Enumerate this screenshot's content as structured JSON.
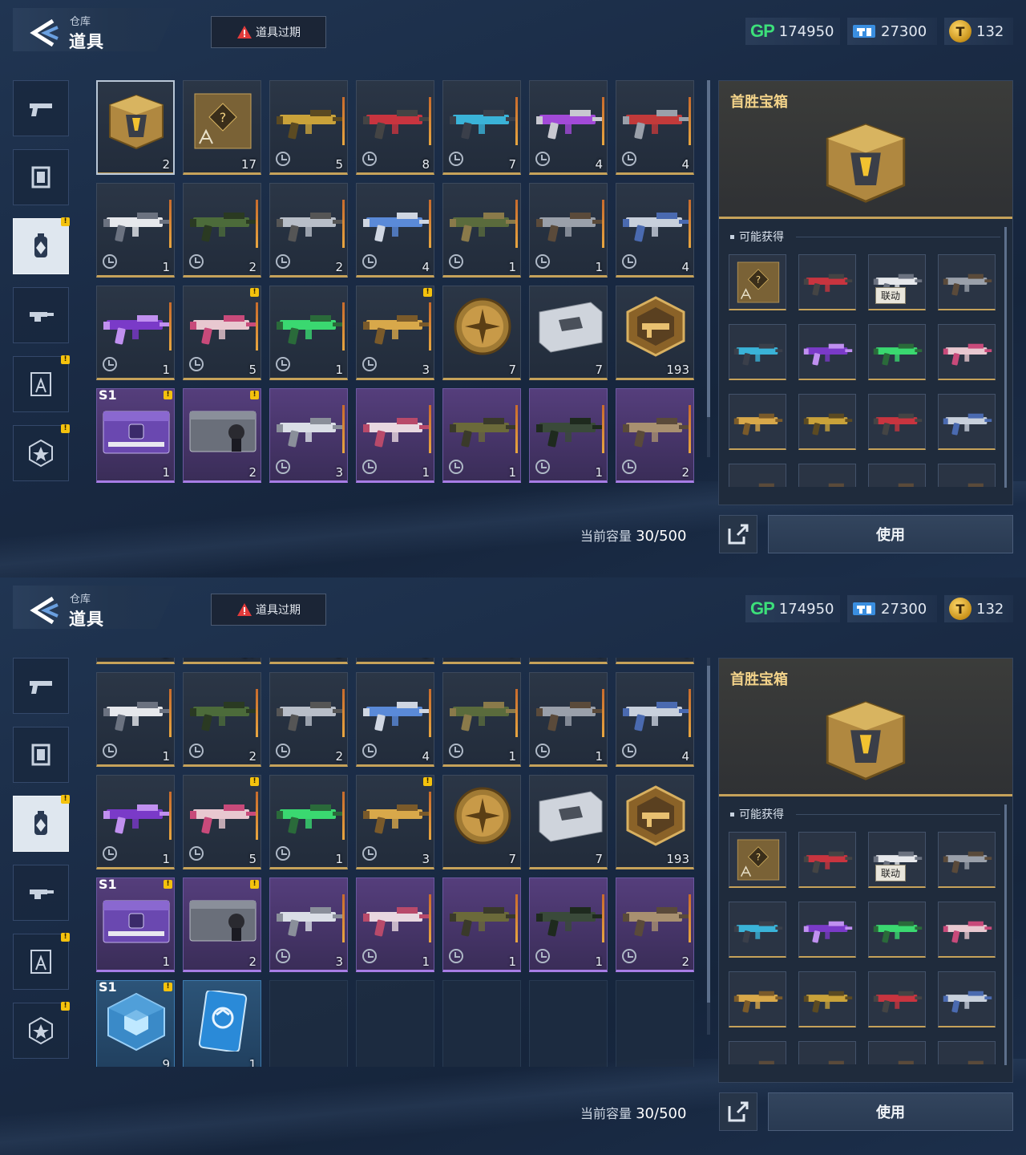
{
  "header": {
    "breadcrumb_small": "仓库",
    "title": "道具",
    "expire_button": "道具过期",
    "currency": {
      "gp_icon": "GP",
      "gp_value": "174950",
      "ticket_value": "27300",
      "coin_value": "132"
    }
  },
  "categories": [
    {
      "icon": "pistol-icon",
      "badge": false,
      "active": false
    },
    {
      "icon": "frame-icon",
      "badge": false,
      "active": false
    },
    {
      "icon": "canister-icon",
      "badge": true,
      "active": true
    },
    {
      "icon": "weapon-mod-icon",
      "badge": false,
      "active": false
    },
    {
      "icon": "blueprint-compass-icon",
      "badge": true,
      "active": false
    },
    {
      "icon": "star-badge-icon",
      "badge": true,
      "active": false
    }
  ],
  "inventory": {
    "rows": [
      [
        {
          "art": "gold-crate",
          "count": "2",
          "rarity": "gold",
          "timed": false,
          "selected": true
        },
        {
          "art": "blueprint-card",
          "count": "17",
          "rarity": "gold",
          "timed": false
        },
        {
          "art": "gun-gold",
          "count": "5",
          "rarity": "gold",
          "timed": true
        },
        {
          "art": "gun-red",
          "count": "8",
          "rarity": "gold",
          "timed": true
        },
        {
          "art": "gun-cyan",
          "count": "7",
          "rarity": "gold",
          "timed": true
        },
        {
          "art": "gun-purple",
          "count": "4",
          "rarity": "gold",
          "timed": true
        },
        {
          "art": "gun-redsilver",
          "count": "4",
          "rarity": "gold",
          "timed": true
        }
      ],
      [
        {
          "art": "gun-white",
          "count": "1",
          "rarity": "gold",
          "timed": true
        },
        {
          "art": "gun-green",
          "count": "2",
          "rarity": "gold",
          "timed": true
        },
        {
          "art": "crossbow-silver",
          "count": "2",
          "rarity": "gold",
          "timed": true
        },
        {
          "art": "crossbow-blue",
          "count": "4",
          "rarity": "gold",
          "timed": true
        },
        {
          "art": "gun-camo",
          "count": "1",
          "rarity": "gold",
          "timed": true
        },
        {
          "art": "gun-grey",
          "count": "1",
          "rarity": "gold",
          "timed": true
        },
        {
          "art": "gun-silverblue",
          "count": "4",
          "rarity": "gold",
          "timed": true
        }
      ],
      [
        {
          "art": "rifle-purple",
          "count": "1",
          "rarity": "gold",
          "timed": true
        },
        {
          "art": "rifle-pink",
          "count": "5",
          "rarity": "gold",
          "timed": true,
          "badge": true
        },
        {
          "art": "gun-neon",
          "count": "1",
          "rarity": "gold",
          "timed": true
        },
        {
          "art": "gun-goldtan",
          "count": "3",
          "rarity": "gold",
          "timed": true,
          "badge": true
        },
        {
          "art": "gold-medal",
          "count": "7",
          "rarity": "gold",
          "timed": false
        },
        {
          "art": "silver-card",
          "count": "7",
          "rarity": "gold",
          "timed": false
        },
        {
          "art": "hex-emblem",
          "count": "193",
          "rarity": "gold",
          "timed": false
        }
      ],
      [
        {
          "art": "purple-case",
          "count": "1",
          "rarity": "purple",
          "timed": false,
          "season": "S1",
          "badge": true
        },
        {
          "art": "grey-case",
          "count": "2",
          "rarity": "purple",
          "timed": false,
          "badge": true
        },
        {
          "art": "blaster-white",
          "count": "3",
          "rarity": "purple",
          "timed": true
        },
        {
          "art": "gun-pinkwhite",
          "count": "1",
          "rarity": "purple",
          "timed": true
        },
        {
          "art": "gun-olive",
          "count": "1",
          "rarity": "purple",
          "timed": true
        },
        {
          "art": "gun-darkgreen",
          "count": "1",
          "rarity": "purple",
          "timed": true
        },
        {
          "art": "gun-tan",
          "count": "2",
          "rarity": "purple",
          "timed": true
        }
      ],
      [
        {
          "art": "blue-cube",
          "count": "9",
          "rarity": "blue",
          "timed": false,
          "season": "S1",
          "badge": true
        },
        {
          "art": "blue-card",
          "count": "1",
          "rarity": "blue",
          "timed": false
        },
        {
          "art": "empty"
        },
        {
          "art": "empty"
        },
        {
          "art": "empty"
        },
        {
          "art": "empty"
        },
        {
          "art": "empty"
        }
      ]
    ],
    "capacity_label": "当前容量",
    "capacity_value": "30/500"
  },
  "detail": {
    "title": "首胜宝箱",
    "may_get_label": "可能获得",
    "rewards": [
      {
        "art": "blueprint-card"
      },
      {
        "art": "gun-red"
      },
      {
        "art": "gun-white",
        "tag": "联动"
      },
      {
        "art": "gun-grey"
      },
      {
        "art": "gun-cyan"
      },
      {
        "art": "rifle-purple"
      },
      {
        "art": "gun-neon"
      },
      {
        "art": "rifle-pink"
      },
      {
        "art": "gun-goldtan"
      },
      {
        "art": "gun-gold"
      },
      {
        "art": "gun-red"
      },
      {
        "art": "gun-silverblue"
      },
      {
        "art": "gun-grey"
      },
      {
        "art": "gun-grey"
      },
      {
        "art": "gun-grey"
      },
      {
        "art": "gun-grey"
      }
    ],
    "use_button": "使用"
  },
  "colors": {
    "gold": "#c6a25a",
    "purple": "#a77de6",
    "blue": "#5aa9e8",
    "badge": "#f4c20d",
    "gp_green": "#3ce07a"
  }
}
